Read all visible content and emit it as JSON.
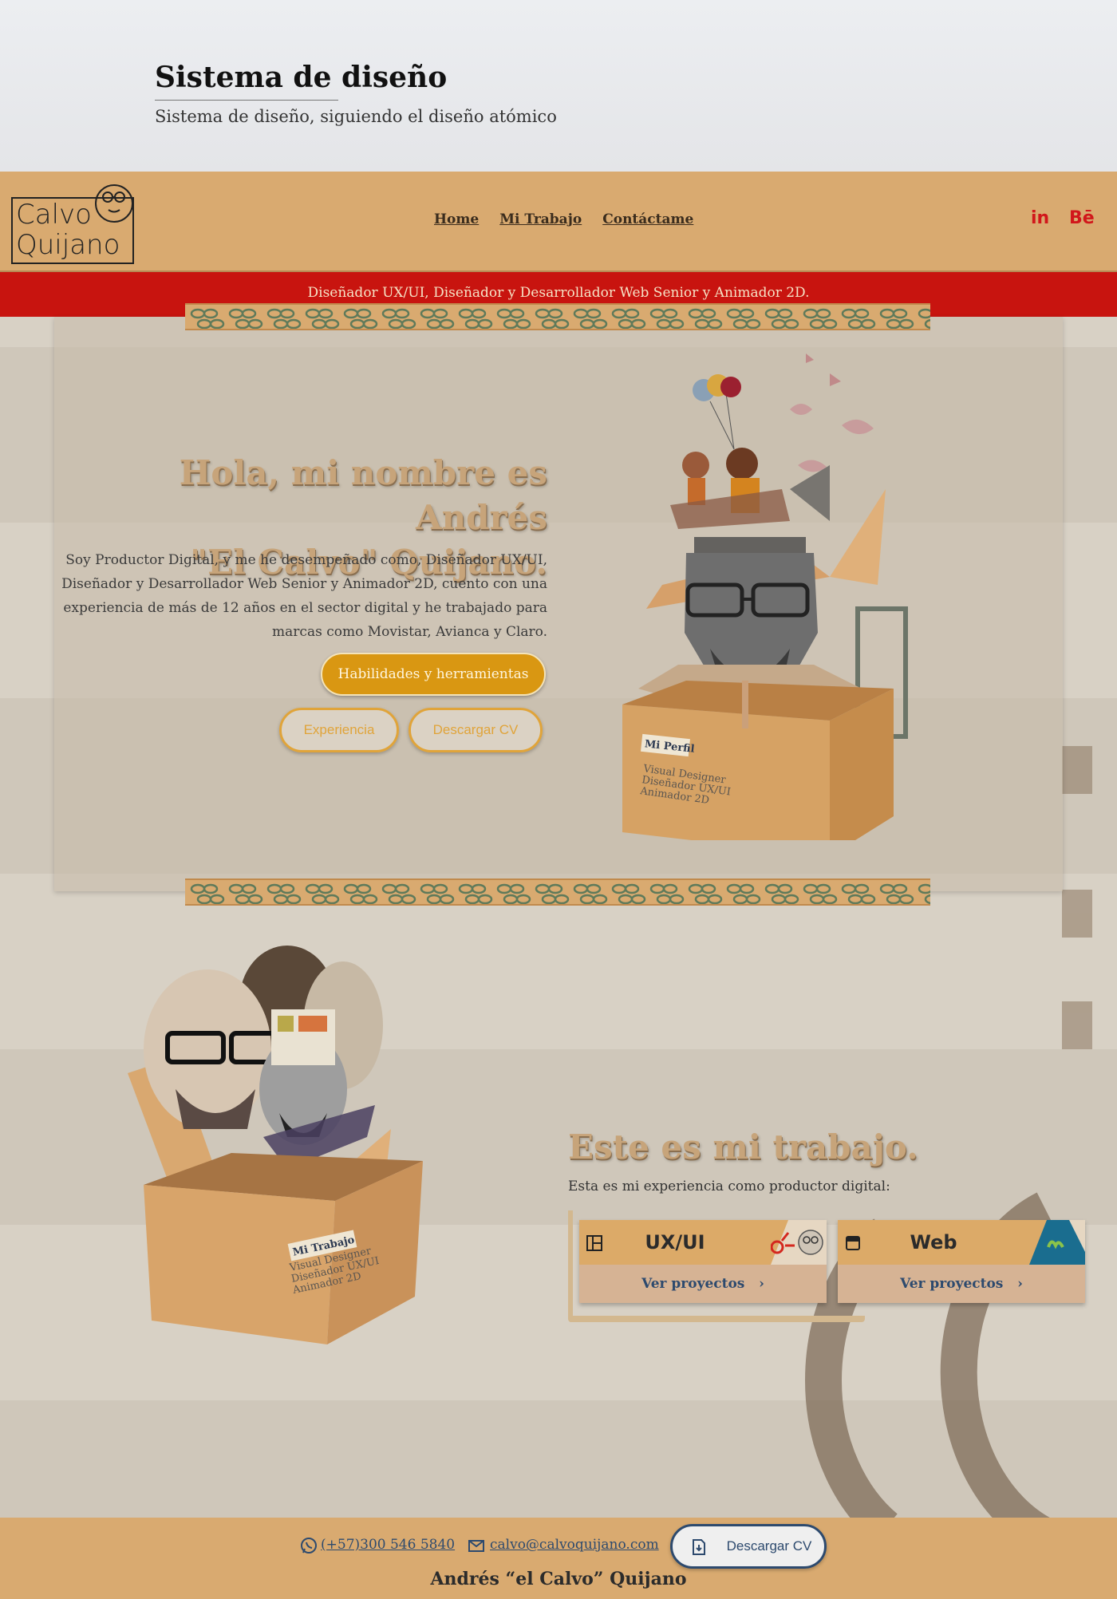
{
  "design_system": {
    "title": "Sistema de diseño",
    "subtitle": "Sistema de diseño, siguiendo el diseño atómico"
  },
  "nav": {
    "logo_line1": "Calvo",
    "logo_line2": "Quijano",
    "links": [
      "Home",
      "Mi Trabajo",
      "Contáctame"
    ],
    "social": {
      "linkedin": "in",
      "behance": "Bē"
    }
  },
  "banner": {
    "text": "Diseñador UX/UI, Diseñador y Desarrollador Web Senior y Animador 2D."
  },
  "hero": {
    "title_line1": "Hola, mi nombre es Andrés",
    "title_line2": "\"El Calvo\" Quijano.",
    "body": "Soy Productor Digital, y me he desempeñado como, Diseñador UX/UI, Diseñador y Desarrollador Web Senior y Animador 2D, cuento con una experiencia de más de 12 años en el sector digital y he trabajado para marcas como Movistar, Avianca y Claro.",
    "btn_skills": "Habilidades y herramientas",
    "btn_experience": "Experiencia",
    "btn_cv": "Descargar CV",
    "box_label": "Mi Perfil",
    "box_lines": [
      "Visual Designer",
      "Diseñador UX/UI",
      "Animador 2D"
    ]
  },
  "work": {
    "title": "Este es mi trabajo.",
    "subtitle": "Esta es mi experiencia como productor digital:",
    "box_label": "Mi Trabajo",
    "box_lines": [
      "Visual Designer",
      "Diseñador UX/UI",
      "Animador 2D"
    ],
    "cards": [
      {
        "title": "UX/UI",
        "link": "Ver proyectos",
        "icon": "layout-icon"
      },
      {
        "title": "Web",
        "link": "Ver proyectos",
        "icon": "browser-icon"
      }
    ]
  },
  "footer": {
    "phone": "(+57)300 546 5840",
    "email": "calvo@calvoquijano.com",
    "cv": "Descargar CV",
    "name": "Andrés “el Calvo” Quijano"
  },
  "colors": {
    "nav_bg": "#d9aa70",
    "banner_red": "#c8140f",
    "accent_gold": "#d99712",
    "link_blue": "#2d4a6e",
    "title_tan": "#c7a47a"
  }
}
